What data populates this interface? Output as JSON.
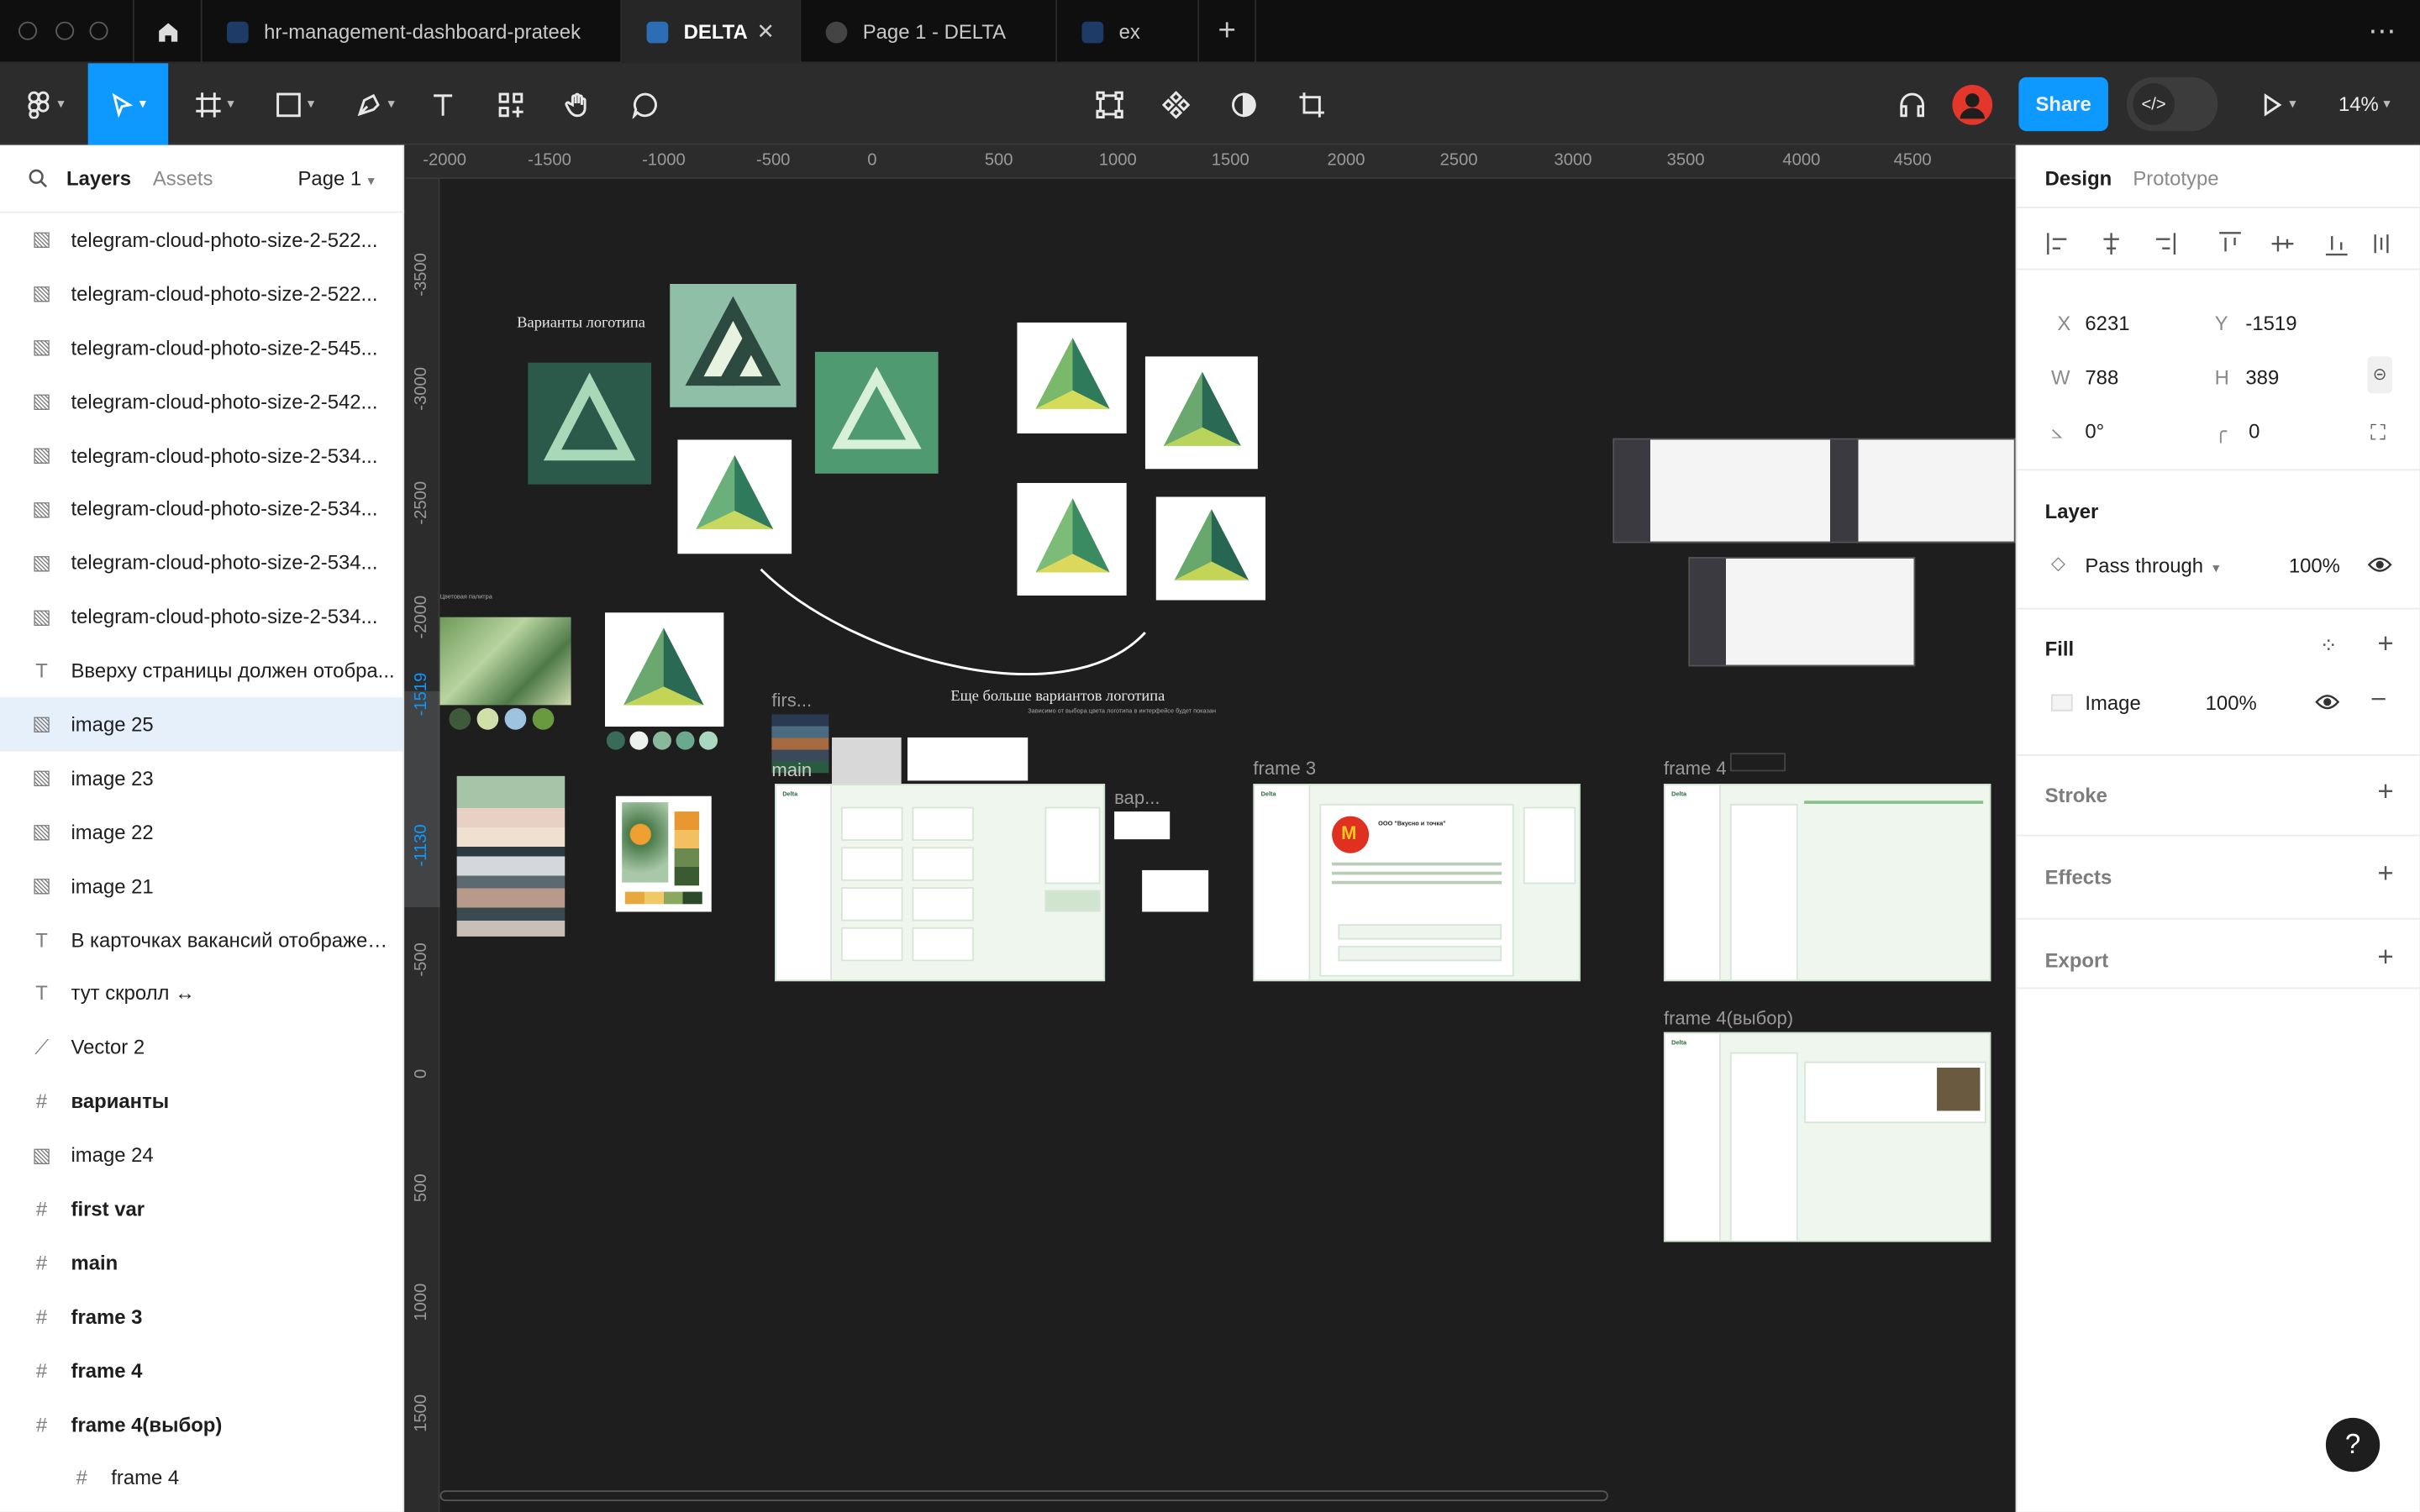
{
  "tabs": [
    {
      "label": "hr-management-dashboard-prateek"
    },
    {
      "label": "DELTA"
    },
    {
      "label": "Page 1 - DELTA"
    },
    {
      "label": "ex"
    }
  ],
  "toolbar": {
    "share_label": "Share",
    "zoom_label": "14%"
  },
  "left_panel": {
    "tabs": {
      "layers": "Layers",
      "assets": "Assets"
    },
    "page_selector": "Page 1",
    "layers": [
      {
        "type": "image",
        "name": "telegram-cloud-photo-size-2-522..."
      },
      {
        "type": "image",
        "name": "telegram-cloud-photo-size-2-522..."
      },
      {
        "type": "image",
        "name": "telegram-cloud-photo-size-2-545..."
      },
      {
        "type": "image",
        "name": "telegram-cloud-photo-size-2-542..."
      },
      {
        "type": "image",
        "name": "telegram-cloud-photo-size-2-534..."
      },
      {
        "type": "image",
        "name": "telegram-cloud-photo-size-2-534..."
      },
      {
        "type": "image",
        "name": "telegram-cloud-photo-size-2-534..."
      },
      {
        "type": "image",
        "name": "telegram-cloud-photo-size-2-534..."
      },
      {
        "type": "text",
        "name": "Вверху страницы должен отобра..."
      },
      {
        "type": "image",
        "name": "image 25",
        "selected": true
      },
      {
        "type": "image",
        "name": "image 23"
      },
      {
        "type": "image",
        "name": "image 22"
      },
      {
        "type": "image",
        "name": "image 21"
      },
      {
        "type": "text",
        "name": "В карточках вакансий отображен..."
      },
      {
        "type": "text",
        "name": "тут скролл ↔"
      },
      {
        "type": "vector",
        "name": "Vector 2"
      },
      {
        "type": "frame",
        "name": "варианты"
      },
      {
        "type": "image",
        "name": "image 24"
      },
      {
        "type": "frame",
        "name": "first var"
      },
      {
        "type": "frame",
        "name": "main"
      },
      {
        "type": "frame",
        "name": "frame 3"
      },
      {
        "type": "frame",
        "name": "frame 4"
      },
      {
        "type": "frame",
        "name": "frame 4(выбор)"
      },
      {
        "type": "frame-child",
        "name": "frame 4"
      }
    ]
  },
  "rulers": {
    "top": [
      "-2000",
      "-1500",
      "-1000",
      "-500",
      "0",
      "500",
      "1000",
      "1500",
      "2000",
      "2500",
      "3000",
      "3500",
      "4000",
      "4500"
    ],
    "left": [
      "-3500",
      "-3000",
      "-2500",
      "-2000",
      "-1519",
      "-1130",
      "-500",
      "0",
      "500",
      "1000",
      "1500"
    ]
  },
  "canvas": {
    "logo_variants_title": "Варианты логотипа",
    "more_variants_title": "Еще больше вариантов логотипа",
    "more_variants_sub": "Зависимо от выбора цвета логотипа в интерфейсе будет показан",
    "palette_label": "Цветовая палитра",
    "frame_labels": {
      "first": "firs...",
      "main": "main",
      "var": "вар...",
      "frame3": "frame 3",
      "frame4": "frame 4",
      "frame4choice": "frame 4(выбор)"
    },
    "frame_brand": "Delta",
    "mcd_title": "ООО \"Вкусно и точка\""
  },
  "right_panel": {
    "tabs": {
      "design": "Design",
      "prototype": "Prototype"
    },
    "x_label": "X",
    "x": "6231",
    "y_label": "Y",
    "y": "-1519",
    "w_label": "W",
    "w": "788",
    "h_label": "H",
    "h": "389",
    "rotation": "0°",
    "radius": "0",
    "layer_title": "Layer",
    "blend_mode": "Pass through",
    "layer_opacity": "100%",
    "fill_title": "Fill",
    "fill_type": "Image",
    "fill_opacity": "100%",
    "stroke_title": "Stroke",
    "effects_title": "Effects",
    "export_title": "Export"
  },
  "help_label": "?",
  "colors": {
    "accent": "#0d99ff",
    "canvas": "#1e1e1e",
    "selection": "#e6f0fb"
  }
}
